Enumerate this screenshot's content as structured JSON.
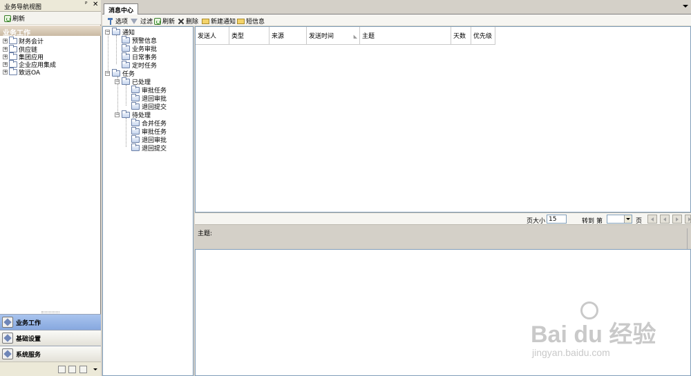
{
  "nav": {
    "title": "业务导航视图",
    "pin": "ᴾ",
    "close": "✕",
    "toolbar_refresh": "刷新",
    "section": "业务工作",
    "tree": [
      {
        "label": "财务会计",
        "expander": "+"
      },
      {
        "label": "供应链",
        "expander": "+"
      },
      {
        "label": "集团应用",
        "expander": "+"
      },
      {
        "label": "企业应用集成",
        "expander": "+"
      },
      {
        "label": "致远OA",
        "expander": "+"
      }
    ],
    "buttons": [
      {
        "label": "业务工作",
        "selected": true
      },
      {
        "label": "基础设置",
        "selected": false
      },
      {
        "label": "系统服务",
        "selected": false
      }
    ]
  },
  "tab": {
    "title": "消息中心"
  },
  "toolbar": {
    "options": "选项",
    "filter": "过滤",
    "refresh": "刷新",
    "delete": "删除",
    "new_notice": "新建通知",
    "sms": "短信息"
  },
  "tree": {
    "notice": {
      "label": "通知",
      "children": [
        "预警信息",
        "业务审批",
        "日常事务",
        "定时任务"
      ]
    },
    "task": {
      "label": "任务",
      "processed": {
        "label": "已处理",
        "children": [
          "审批任务",
          "退回审批",
          "退回提交"
        ]
      },
      "pending": {
        "label": "待处理",
        "children": [
          "合并任务",
          "审批任务",
          "退回审批",
          "退回提交"
        ]
      }
    },
    "expander": "−"
  },
  "grid": {
    "columns": [
      "发送人",
      "类型",
      "来源",
      "发送时间",
      "主题",
      "天数",
      "优先级"
    ],
    "sort_mark": "◣"
  },
  "pager": {
    "page_size_label": "页大小",
    "page_size": "15",
    "goto_label": "转到",
    "page_prefix": "第",
    "page_suffix": "页"
  },
  "detail": {
    "subject_label": "主题:"
  },
  "watermark": {
    "brand": "Bai  du 经验",
    "url": "jingyan.baidu.com"
  }
}
